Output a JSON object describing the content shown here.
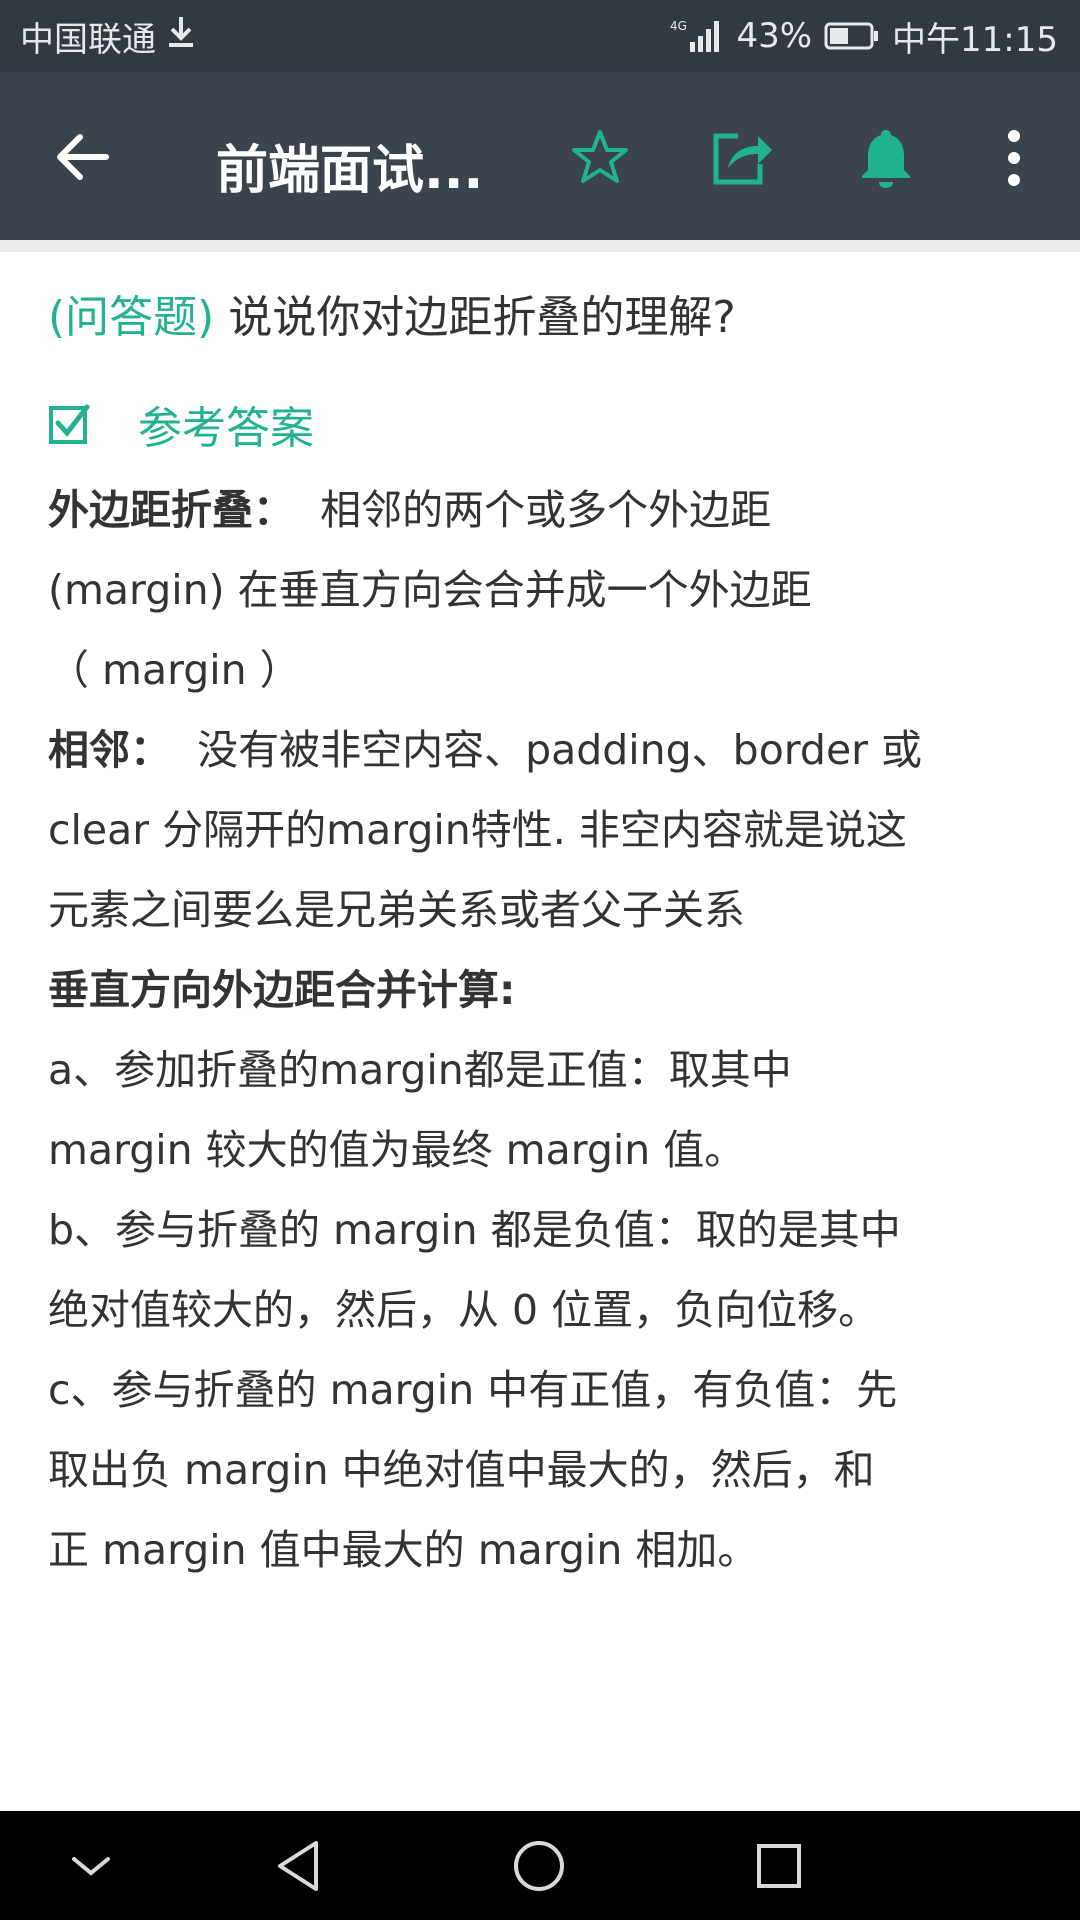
{
  "status_bar": {
    "carrier": "中国联通",
    "network": "4G",
    "battery": "43%",
    "time": "中午11:15"
  },
  "app_bar": {
    "title": "前端面试...",
    "icons": [
      "back-arrow-icon",
      "star-icon",
      "share-icon",
      "bell-icon",
      "more-vert-icon"
    ],
    "accent_color": "#21b391"
  },
  "question": {
    "type": "(问答题)",
    "text": " 说说你对边距折叠的理解?"
  },
  "answer": {
    "title": "参考答案",
    "lines": [
      {
        "bold": "外边距折叠：",
        "text": "  相邻的两个或多个外边距"
      },
      {
        "bold": "",
        "text": "(margin) 在垂直方向会合并成一个外边距"
      },
      {
        "bold": "",
        "text": "（ margin ）"
      },
      {
        "bold": "相邻：",
        "text": "  没有被非空内容、padding、border 或"
      },
      {
        "bold": "",
        "text": "clear 分隔开的margin特性. 非空内容就是说这"
      },
      {
        "bold": "",
        "text": "元素之间要么是兄弟关系或者父子关系"
      },
      {
        "bold": "垂直方向外边距合并计算:",
        "text": ""
      },
      {
        "bold": "",
        "text": "a、参加折叠的margin都是正值：取其中"
      },
      {
        "bold": "",
        "text": "margin 较大的值为最终 margin 值。"
      },
      {
        "bold": "",
        "text": "b、参与折叠的 margin 都是负值：取的是其中"
      },
      {
        "bold": "",
        "text": "绝对值较大的，然后，从 0 位置，负向位移。"
      },
      {
        "bold": "",
        "text": "c、参与折叠的 margin 中有正值，有负值：先"
      },
      {
        "bold": "",
        "text": "取出负 margin 中绝对值中最大的，然后，和"
      },
      {
        "bold": "",
        "text": "正 margin 值中最大的 margin 相加。"
      }
    ]
  },
  "nav_bar": {
    "icons": [
      "hide-keyboard-icon",
      "nav-back-icon",
      "nav-home-icon",
      "nav-recent-icon"
    ]
  }
}
